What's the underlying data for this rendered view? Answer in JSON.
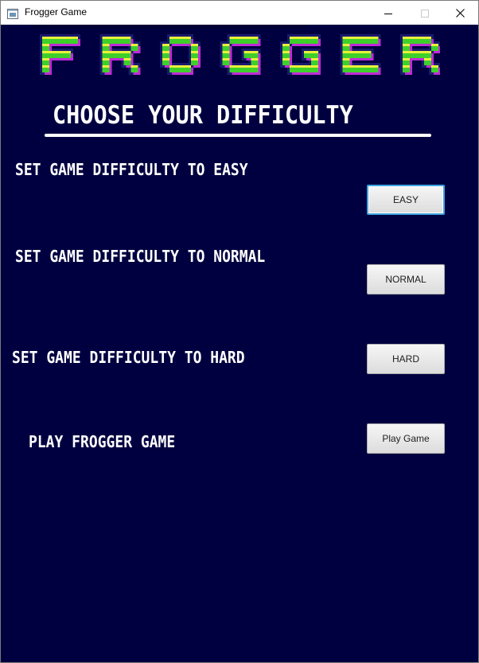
{
  "window": {
    "title": "Frogger Game",
    "icon": "java-app-icon",
    "controls": {
      "minimize_icon": "minimize-icon",
      "maximize_icon": "maximize-icon",
      "close_icon": "close-icon"
    }
  },
  "logo": {
    "text": "FROGGER",
    "letters": [
      "F",
      "R",
      "O",
      "G",
      "G",
      "E",
      "R"
    ],
    "colors": {
      "fill": "#3ecf2a",
      "highlight": "#e8f03a",
      "shadow": "#c02ad8",
      "outline": "#1a1a6e"
    }
  },
  "heading": "CHOOSE YOUR DIFFICULTY",
  "options": {
    "easy": {
      "label": "SET GAME DIFFICULTY TO EASY",
      "button": "EASY"
    },
    "normal": {
      "label": "SET GAME DIFFICULTY TO NORMAL",
      "button": "NORMAL"
    },
    "hard": {
      "label": "SET GAME DIFFICULTY TO HARD",
      "button": "HARD"
    },
    "play": {
      "label": "PLAY FROGGER GAME",
      "button": "Play Game"
    }
  },
  "colors": {
    "background": "#000040",
    "text": "#ffffff",
    "focus_ring": "#3fa3e0",
    "button_face": "#e6e6e6"
  }
}
